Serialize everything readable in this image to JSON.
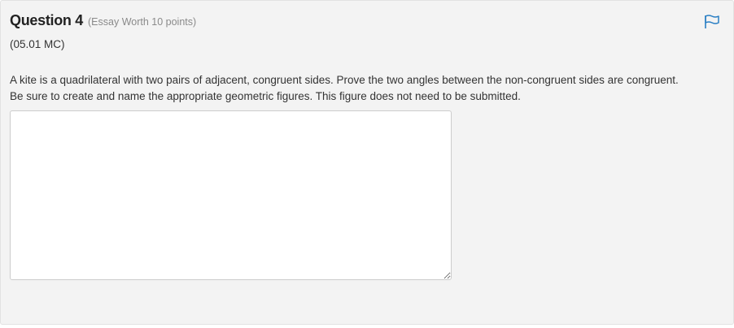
{
  "question": {
    "title": "Question 4",
    "worth": "(Essay Worth 10 points)",
    "code": "(05.01 MC)",
    "prompt_line1": "A kite is a quadrilateral with two pairs of adjacent, congruent sides. Prove the two angles between the non-congruent sides are congruent.",
    "prompt_line2": "Be sure to create and name the appropriate geometric figures. This figure does not need to be submitted."
  },
  "answer": {
    "value": "",
    "placeholder": ""
  },
  "icons": {
    "flag": "flag-icon"
  },
  "colors": {
    "flag_accent": "#2a7fc4",
    "panel_background": "#f3f3f3"
  }
}
